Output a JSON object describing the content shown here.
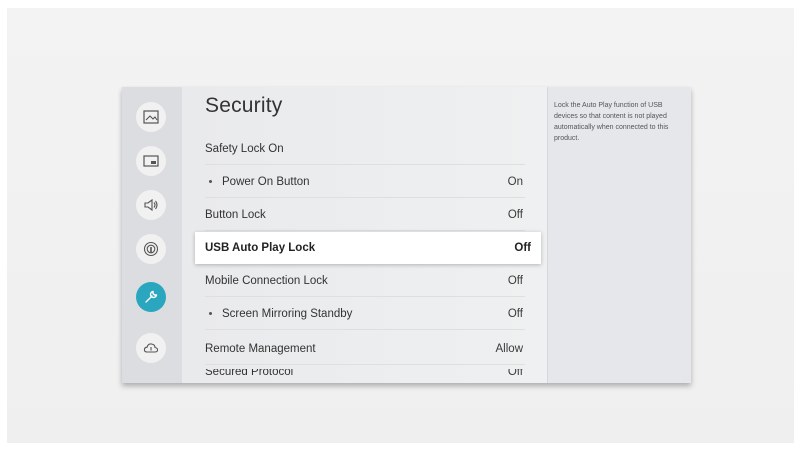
{
  "page": {
    "title": "Security"
  },
  "rail": {
    "items": [
      {
        "name": "picture",
        "icon": "picture-icon"
      },
      {
        "name": "broadcast",
        "icon": "screen-icon"
      },
      {
        "name": "sound",
        "icon": "speaker-icon"
      },
      {
        "name": "network",
        "icon": "network-icon"
      },
      {
        "name": "general",
        "icon": "wrench-icon",
        "active": true
      },
      {
        "name": "support",
        "icon": "cloud-icon"
      }
    ],
    "active_color": "#2aa7bf"
  },
  "menu": {
    "items": [
      {
        "label": "Safety Lock On",
        "value": ""
      },
      {
        "label": "Power On Button",
        "value": "On",
        "sub": true
      },
      {
        "label": "Button Lock",
        "value": "Off"
      },
      {
        "label": "USB Auto Play Lock",
        "value": "Off",
        "selected": true
      },
      {
        "label": "Mobile Connection Lock",
        "value": "Off"
      },
      {
        "label": "Screen Mirroring Standby",
        "value": "Off",
        "sub": true
      },
      {
        "label": "Remote Management",
        "value": "Allow"
      },
      {
        "label": "Secured Protocol",
        "value": "Off"
      }
    ]
  },
  "help": {
    "text": "Lock the Auto Play function of USB devices so that content is not played automatically when connected to this product."
  }
}
